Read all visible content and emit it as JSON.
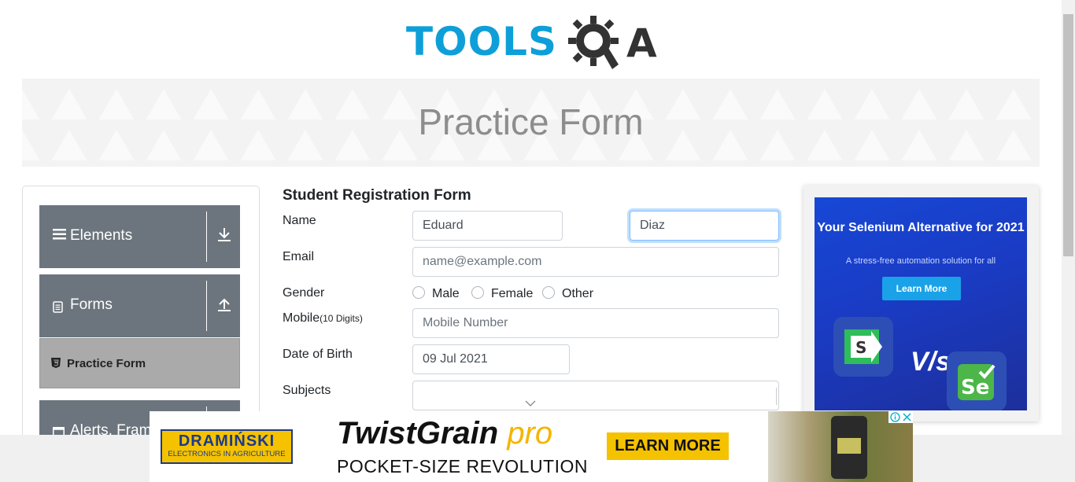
{
  "header": {
    "logo_text_tools": "TOOLS",
    "logo_text_qa": "A"
  },
  "banner": {
    "title": "Practice Form"
  },
  "sidebar": {
    "groups": [
      {
        "label": "Elements",
        "icon": "hamburger-icon",
        "arrow": "download-arrow-icon"
      },
      {
        "label": "Forms",
        "icon": "document-icon",
        "arrow": "upload-arrow-icon"
      },
      {
        "label": "Alerts, Fram",
        "icon": "window-icon"
      }
    ],
    "active_item": {
      "label": "Practice Form",
      "icon": "html5-icon"
    }
  },
  "form": {
    "title": "Student Registration Form",
    "name_label": "Name",
    "first_name_value": "Eduard",
    "last_name_value": "Diaz",
    "email_label": "Email",
    "email_placeholder": "name@example.com",
    "gender_label": "Gender",
    "gender_options": [
      "Male",
      "Female",
      "Other"
    ],
    "mobile_label": "Mobile",
    "mobile_hint": "(10 Digits)",
    "mobile_placeholder": "Mobile Number",
    "dob_label": "Date of Birth",
    "dob_value": "09 Jul 2021",
    "subjects_label": "Subjects"
  },
  "right_ad": {
    "headline": "Your Selenium Alternative for 2021",
    "subtext": "A stress-free automation solution for all",
    "button": "Learn More",
    "vs_text": "V/s",
    "colors": {
      "background": "#1a3bc4",
      "button": "#1aa2e8"
    }
  },
  "bottom_ad": {
    "brand": "DRAMIŃSKI",
    "brand_tagline": "ELECTRONICS IN AGRICULTURE",
    "product_name": "TwistGrain",
    "product_suffix": "pro",
    "tagline": "POCKET-SIZE REVOLUTION",
    "cta": "LEARN MORE",
    "colors": {
      "brand": "#1b3a8c",
      "accent": "#f5c200"
    }
  },
  "colors": {
    "logo_blue": "#0e9fd8",
    "logo_dark": "#333333",
    "sidebar_header": "#6c757d",
    "focus_border": "#80bdff"
  }
}
